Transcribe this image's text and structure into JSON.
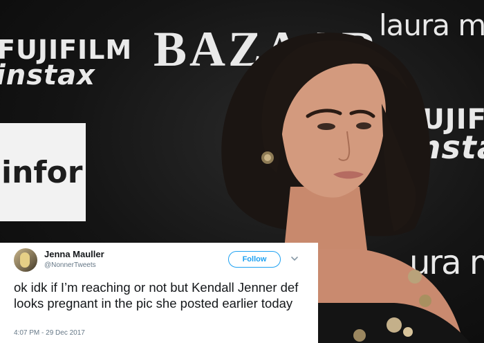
{
  "photo": {
    "backdrop": {
      "fuji_left_line1": "FUJIFILM",
      "fuji_left_line2": "instax",
      "bazaar_logo": "BAZAAR",
      "laura_top": "laura me",
      "fuji_right_line1": "FUJIFI",
      "fuji_right_line2": "instax",
      "laura_right": "ura m",
      "infor_logo": "infor"
    }
  },
  "tweet": {
    "display_name": "Jenna Mauller",
    "handle": "@NonnerTweets",
    "follow_label": "Follow",
    "text": "ok idk if I’m reaching or not but Kendall Jenner def looks pregnant in the pic she posted earlier today",
    "timestamp": "4:07 PM - 29 Dec 2017",
    "accent_color": "#1da1f2",
    "icons": [
      "avatar-image",
      "chevron-down-icon"
    ]
  }
}
